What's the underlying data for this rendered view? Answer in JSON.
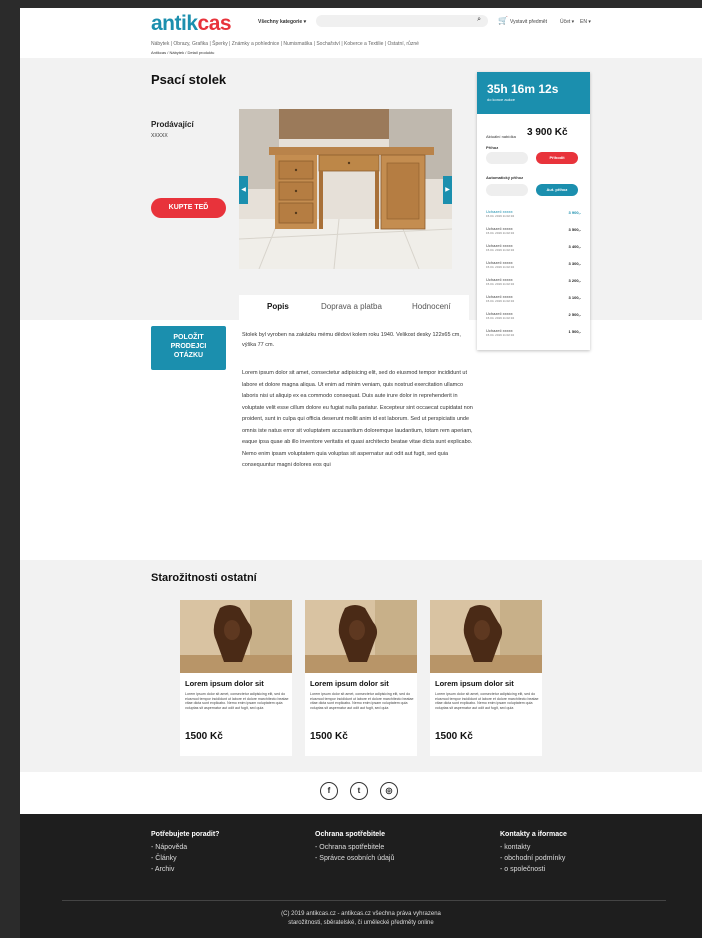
{
  "header": {
    "logo_part1": "antik",
    "logo_part2": "cas",
    "category_select": "Všechny kategorie",
    "login_link": "Vystavit předmět",
    "account_link": "Účet",
    "lang_link": "EN"
  },
  "nav": {
    "categories": "Nábytek  |  Obrazy, Grafika  |  Šperky  |  Známky a pohlednice  |  Numismatika  |  Sochařství  |  Koberce a Textilie  |  Ostatní, různé",
    "breadcrumb": "Antikcas / Nábytek / Detail produktu"
  },
  "product": {
    "title": "Psací stolek",
    "seller_label": "Prodávající",
    "seller_name": "XXXXX",
    "buy_button": "KUPTE TEĎ",
    "question_button_line1": "POLOŽIT",
    "question_button_line2": "PRODEJCI",
    "question_button_line3": "OTÁZKU",
    "tabs": [
      "Popis",
      "Doprava a platba",
      "Hodnocení"
    ],
    "desc_short": "Stolek byl vyroben na zakázku mému dědovi kolem roku 1940. Velikost desky 122x65 cm, výška 77 cm.",
    "desc_long": "Lorem ipsum dolor sit amet, consectetur adipisicing elit, sed do eiusmod tempor incididunt ut labore et dolore magna aliqua. Ut enim ad minim veniam, quis nostrud exercitation ullamco laboris nisi ut aliquip ex ea commodo consequat. Duis aute irure dolor in reprehenderit in voluptate velit esse cillum dolore eu fugiat nulla pariatur. Excepteur sint occaecat cupidatat non proident, sunt in culpa qui officia deserunt mollit anim id est laborum. Sed ut perspiciatis unde omnis iste natus error sit voluptatem accusantium doloremque laudantium, totam rem aperiam, eaque ipsa quae ab illo inventore veritatis et quasi architecto beatae vitae dicta sunt explicabo. Nemo enim ipsam voluptatem quia voluptas sit aspernatur aut odit aut fugit, sed quia consequuntur magni dolores eos qui"
  },
  "auction": {
    "timer": "35h 16m 12s",
    "timer_sub": "do konce aukce",
    "current_label": "Aktuální nabídka",
    "current_price": "3 900 Kč",
    "bid_label": "Příhoz",
    "bid_button": "Přihodit",
    "auto_label": "Automatický příhoz",
    "auto_button": "Aut. příhoz",
    "bids": [
      {
        "name": "Uchazeč xxxxx",
        "date": "15.04. 2019 11:02:32",
        "amount": "3 900,-"
      },
      {
        "name": "Uchazeč xxxxx",
        "date": "15.04. 2019 11:02:32",
        "amount": "3 500,-"
      },
      {
        "name": "Uchazeč xxxxx",
        "date": "15.04. 2019 11:02:32",
        "amount": "3 400,-"
      },
      {
        "name": "Uchazeč xxxxx",
        "date": "15.04. 2019 11:02:32",
        "amount": "3 300,-"
      },
      {
        "name": "Uchazeč xxxxx",
        "date": "15.04. 2019 11:02:32",
        "amount": "3 200,-"
      },
      {
        "name": "Uchazeč xxxxx",
        "date": "15.04. 2019 11:02:32",
        "amount": "3 100,-"
      },
      {
        "name": "Uchazeč xxxxx",
        "date": "15.04. 2019 11:02:32",
        "amount": "2 500,-"
      },
      {
        "name": "Uchazeč xxxxx",
        "date": "15.04. 2019 11:02:32",
        "amount": "1 500,-"
      }
    ]
  },
  "others": {
    "title": "Starožitnosti ostatní",
    "cards": [
      {
        "title": "Lorem ipsum dolor sit",
        "text": "Lorem ipsum dolor sit amet, consectetur adipisicing elit, sed do eiusmod tempor incididunt ut labore et dolore marchitecto beatae vitae dicta sunt explicabo. Nemo enim ipsam voluptatem quia voluptas sit aspernatur aut odit aut fugit, sed quia",
        "price": "1500 Kč"
      },
      {
        "title": "Lorem ipsum dolor sit",
        "text": "Lorem ipsum dolor sit amet, consectetur adipisicing elit, sed do eiusmod tempor incididunt ut labore et dolore marchitecto beatae vitae dicta sunt explicabo. Nemo enim ipsam voluptatem quia voluptas sit aspernatur aut odit aut fugit, sed quia",
        "price": "1500 Kč"
      },
      {
        "title": "Lorem ipsum dolor sit",
        "text": "Lorem ipsum dolor sit amet, consectetur adipisicing elit, sed do eiusmod tempor incididunt ut labore et dolore marchitecto beatae vitae dicta sunt explicabo. Nemo enim ipsam voluptatem quia voluptas sit aspernatur aut odit aut fugit, sed quia",
        "price": "1500 Kč"
      }
    ]
  },
  "social": {
    "facebook": "f",
    "twitter": "t",
    "instagram": "◎"
  },
  "footer": {
    "col1": {
      "title": "Potřebujete poradit?",
      "items": [
        "- Nápověda",
        "- Články",
        "- Archiv"
      ]
    },
    "col2": {
      "title": "Ochrana spotřebitele",
      "items": [
        "- Ochrana spotřebitele",
        "- Správce osobních údajů"
      ]
    },
    "col3": {
      "title": "Kontakty a iformace",
      "items": [
        "- kontakty",
        "- obchodní podmínky",
        "- o společnosti"
      ]
    },
    "copyright_line1": "(C) 2019 antikcas.cz - antikcas.cz všechna práva vyhrazena",
    "copyright_line2": "starožitnosti, sběratelské, či umělecké předměty online"
  },
  "colors": {
    "brand": "#1b8fae",
    "accent": "#e8333b",
    "footer_bg": "#1e1e1e"
  }
}
